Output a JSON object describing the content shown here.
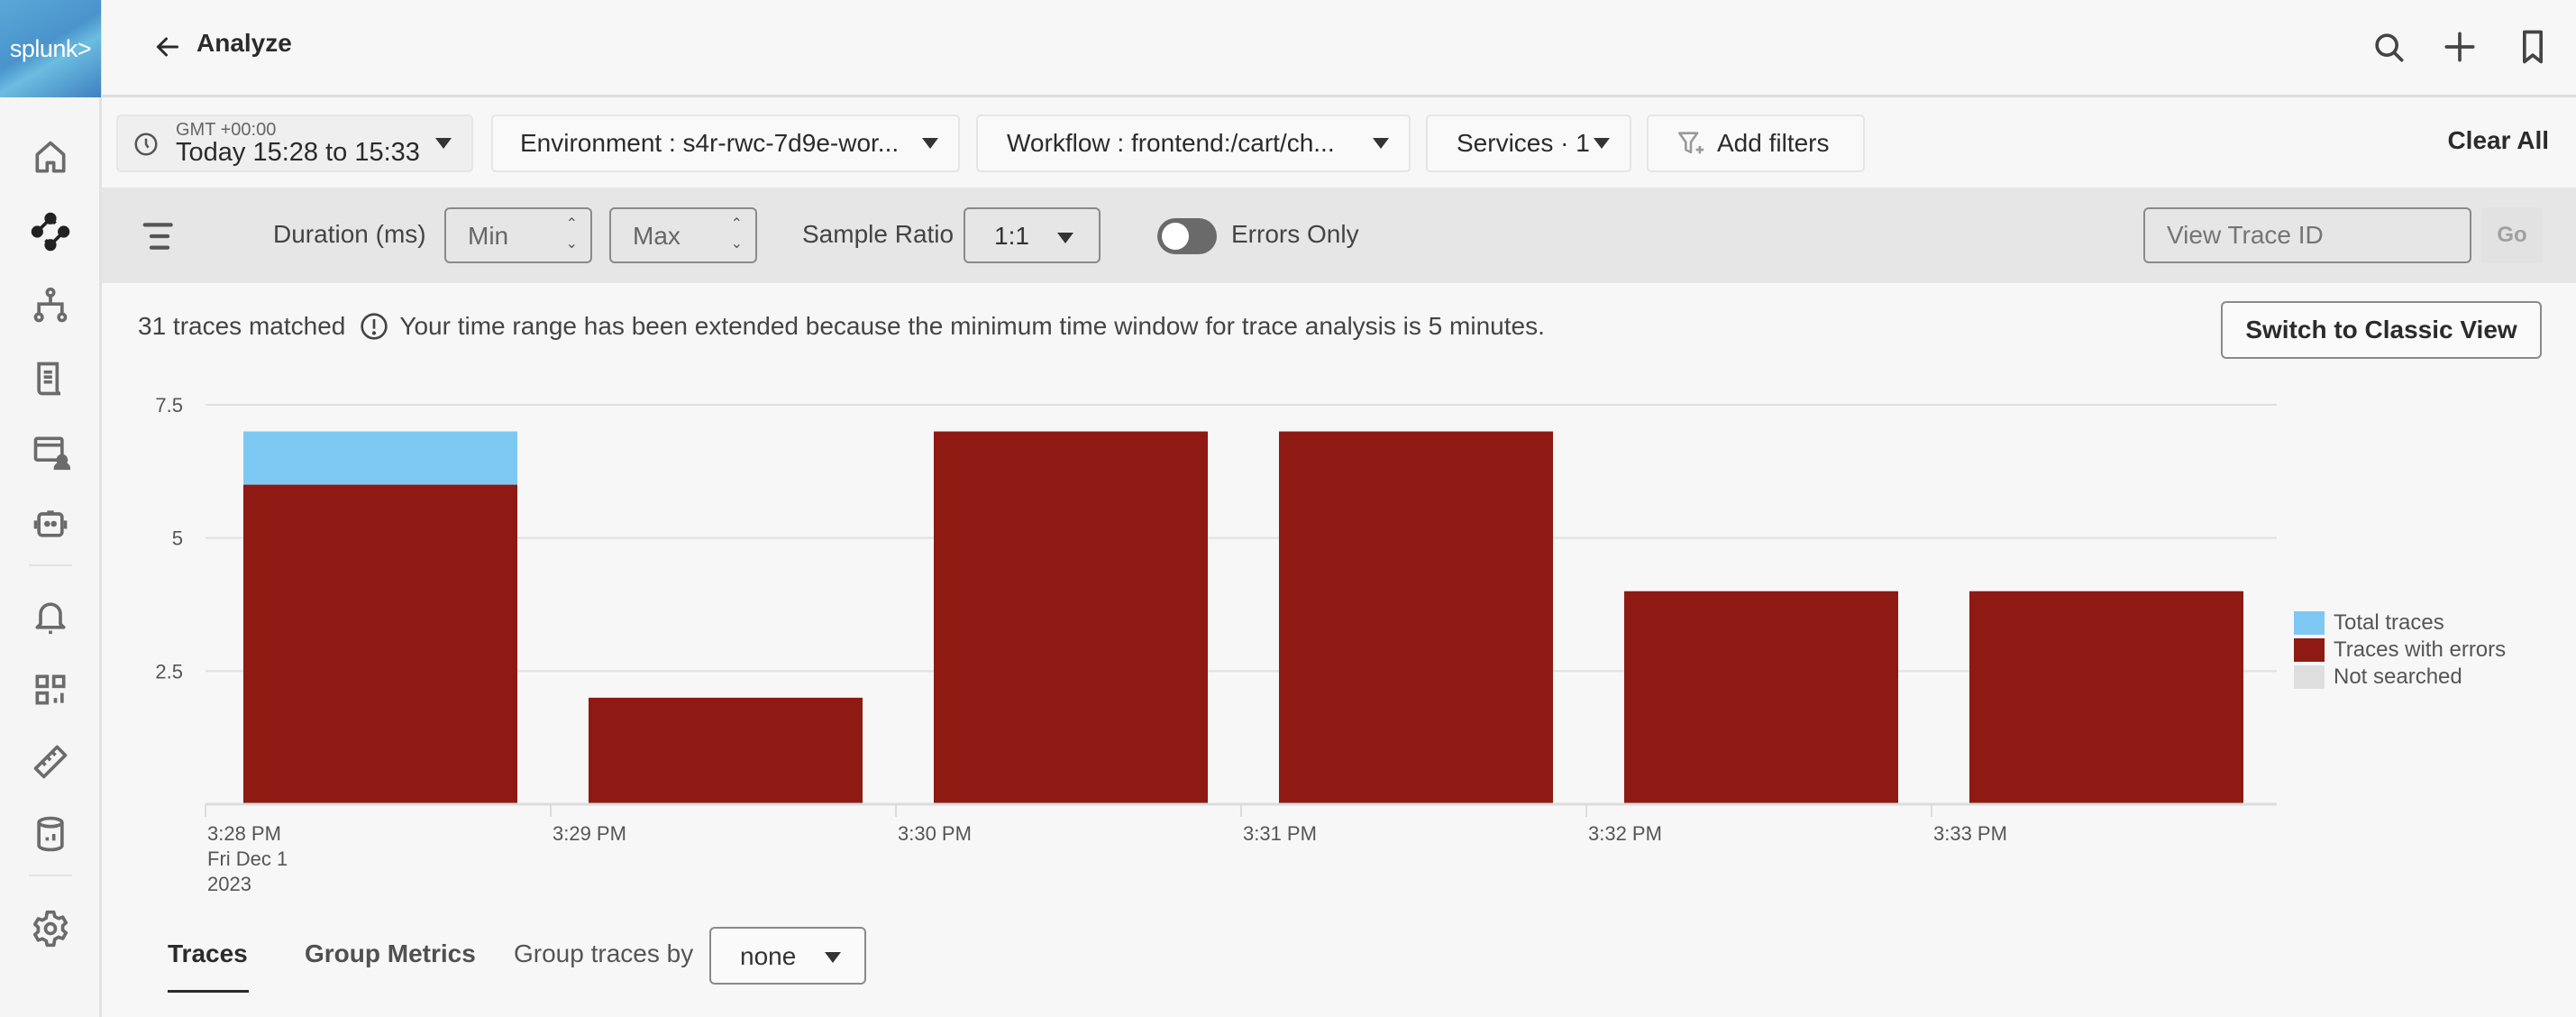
{
  "app": {
    "logo_text": "splunk>",
    "page_title": "Analyze"
  },
  "sidebar": {
    "items": [
      {
        "name": "home",
        "icon": "home-icon"
      },
      {
        "name": "apm",
        "icon": "apm-nodes-icon",
        "active": true
      },
      {
        "name": "service-map",
        "icon": "hierarchy-icon"
      },
      {
        "name": "logs",
        "icon": "document-icon"
      },
      {
        "name": "rum",
        "icon": "browser-user-icon"
      },
      {
        "name": "synthetics",
        "icon": "robot-icon"
      },
      {
        "name": "alerts",
        "icon": "bell-icon"
      },
      {
        "name": "dashboards",
        "icon": "dashboard-grid-icon"
      },
      {
        "name": "metrics",
        "icon": "ruler-icon"
      },
      {
        "name": "data-management",
        "icon": "database-icon"
      },
      {
        "name": "settings",
        "icon": "gear-icon"
      }
    ]
  },
  "header_actions": [
    "search-icon",
    "plus-icon",
    "bookmark-icon"
  ],
  "filters": {
    "timezone": "GMT +00:00",
    "time_range": "Today 15:28 to 15:33",
    "environment": "Environment : s4r-rwc-7d9e-wor...",
    "workflow": "Workflow : frontend:/cart/ch...",
    "services": "Services · 1",
    "add_filters": "Add filters",
    "clear_all": "Clear All"
  },
  "toolbar": {
    "duration_label": "Duration (ms)",
    "min_placeholder": "Min",
    "max_placeholder": "Max",
    "sample_ratio_label": "Sample Ratio",
    "sample_ratio_value": "1:1",
    "errors_only_label": "Errors Only",
    "errors_only_on": false,
    "trace_id_placeholder": "View Trace ID",
    "go_label": "Go"
  },
  "summary": {
    "count_text": "31 traces matched",
    "notice": "Your time range has been extended because the minimum time window for trace analysis is 5 minutes.",
    "classic_view_button": "Switch to Classic View"
  },
  "colors": {
    "total_traces": "#7ec8f4",
    "traces_with_errors": "#8e1a13",
    "not_searched": "#dedede"
  },
  "chart_data": {
    "type": "bar",
    "stacked": true,
    "title": "",
    "xlabel": "",
    "ylabel": "",
    "categories": [
      "3:28 PM",
      "3:29 PM",
      "3:30 PM",
      "3:31 PM",
      "3:32 PM",
      "3:33 PM"
    ],
    "x_tick_labels": [
      [
        "3:28 PM",
        "Fri Dec 1",
        "2023"
      ],
      [
        "3:29 PM"
      ],
      [
        "3:30 PM"
      ],
      [
        "3:31 PM"
      ],
      [
        "3:32 PM"
      ],
      [
        "3:33 PM"
      ]
    ],
    "series": [
      {
        "name": "Traces with errors",
        "values": [
          6,
          2,
          7,
          7,
          4,
          4
        ]
      },
      {
        "name": "Total traces",
        "values": [
          7,
          2,
          7,
          7,
          4,
          4
        ]
      },
      {
        "name": "Not searched",
        "values": [
          0,
          0,
          0,
          0,
          0,
          0
        ]
      }
    ],
    "y_ticks": [
      2.5,
      5,
      7.5
    ],
    "y_tick_labels": [
      "2.5",
      "5",
      "7.5"
    ],
    "ylim": [
      0,
      7.5
    ],
    "grid": true,
    "legend": {
      "position": "right",
      "entries": [
        "Total traces",
        "Traces with errors",
        "Not searched"
      ]
    }
  },
  "tabs": {
    "items": [
      "Traces",
      "Group Metrics"
    ],
    "active": "Traces",
    "group_by_label": "Group traces by",
    "group_by_value": "none"
  }
}
